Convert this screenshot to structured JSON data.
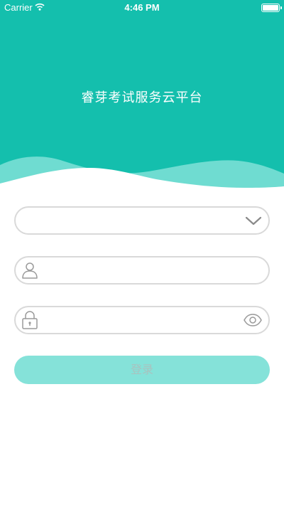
{
  "status_bar": {
    "carrier": "Carrier",
    "time": "4:46 PM"
  },
  "header": {
    "title": "睿芽考试服务云平台"
  },
  "form": {
    "exam_select": {
      "value": ""
    },
    "username": {
      "value": "",
      "placeholder": ""
    },
    "password": {
      "value": "",
      "placeholder": ""
    },
    "login_label": "登录"
  },
  "colors": {
    "brand": "#14bfad",
    "wave": "#6fdcd1",
    "button": "#85e2d9",
    "border": "#d9d9d9"
  },
  "icons": [
    "wifi-icon",
    "battery-icon",
    "chevron-down-icon",
    "user-icon",
    "lock-icon",
    "eye-icon"
  ]
}
